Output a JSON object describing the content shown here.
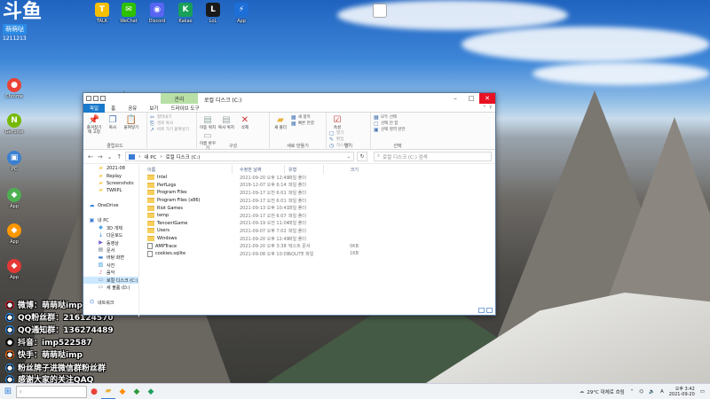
{
  "desktop": {
    "icons_top": [
      {
        "label": "TALK",
        "color": "#f6c000",
        "glyph": "T",
        "icon": "talk-icon"
      },
      {
        "label": "WeChat",
        "color": "#2dc100",
        "glyph": "✉",
        "icon": "wechat-icon"
      },
      {
        "label": "Discord",
        "color": "#5865f2",
        "glyph": "◉",
        "icon": "discord-icon"
      },
      {
        "label": "Kakao",
        "color": "#19a058",
        "glyph": "K",
        "icon": "app-icon"
      },
      {
        "label": "LoL",
        "color": "#1a1a1a",
        "glyph": "L",
        "icon": "game-icon"
      },
      {
        "label": "App",
        "color": "#1e6ed8",
        "glyph": "⚡",
        "icon": "bolt-icon"
      }
    ],
    "icons_left": [
      {
        "label": "Chrome",
        "color": "#e94235",
        "glyph": "●",
        "icon": "chrome-icon"
      },
      {
        "label": "GeForce",
        "color": "#76b900",
        "glyph": "N",
        "icon": "nvidia-icon"
      },
      {
        "label": "PC",
        "color": "#3a80d2",
        "glyph": "▣",
        "icon": "computer-icon"
      },
      {
        "label": "App",
        "color": "#4caf50",
        "glyph": "◆",
        "icon": "app-icon"
      },
      {
        "label": "App",
        "color": "#ff9800",
        "glyph": "◆",
        "icon": "app-icon"
      },
      {
        "label": "App",
        "color": "#e53935",
        "glyph": "◆",
        "icon": "app-icon"
      }
    ],
    "icons_right": [
      {
        "label": "",
        "color": "#ffffff",
        "glyph": "",
        "icon": "document-icon"
      }
    ]
  },
  "overlay": {
    "logo_big": "斗鱼",
    "logo_tag": "萌萌哒",
    "logo_num": "1211213",
    "lines": [
      {
        "text": "微博：萌萌哒imp",
        "color": "#e6162d"
      },
      {
        "text": "QQ粉丝群：216124570",
        "color": "#1e90ff"
      },
      {
        "text": "QQ通知群：136274489",
        "color": "#1e90ff"
      },
      {
        "text": "抖音：imp522587",
        "color": "#111111"
      },
      {
        "text": "快手：萌萌哒imp",
        "color": "#ff6a00"
      },
      {
        "text": "粉丝牌子进微信群粉丝群",
        "color": "#2b8be6"
      },
      {
        "text": "感谢大家的关注QAQ",
        "color": "#2b8be6"
      }
    ]
  },
  "explorer": {
    "title": "로컬 디스크 (C:)",
    "context_tab": "관리",
    "tabs": [
      "파일",
      "홈",
      "공유",
      "보기",
      "드라이브 도구"
    ],
    "ribbon": {
      "clipboard": {
        "label": "클립보드",
        "pin": "즐겨찾기에 고정",
        "copy": "복사",
        "paste": "붙여넣기",
        "cut": "잘라내기",
        "copy_path": "경로 복사",
        "paste_shortcut": "바로 가기 붙여넣기"
      },
      "organize": {
        "label": "구성",
        "move": "이동 위치",
        "copyto": "복사 위치",
        "delete": "삭제",
        "rename": "이름 바꾸기"
      },
      "new": {
        "label": "새로 만들기",
        "folder": "새 폴더",
        "item": "새 항목",
        "easy": "빠른 연결"
      },
      "open": {
        "label": "열기",
        "props": "속성",
        "open": "열기",
        "edit": "편집",
        "history": "히스토리"
      },
      "select": {
        "label": "선택",
        "all": "모두 선택",
        "none": "선택 안 함",
        "invert": "선택 영역 반전"
      }
    },
    "address": {
      "crumbs": [
        "내 PC",
        "로컬 디스크 (C:)"
      ],
      "search_placeholder": "로컬 디스크 (C:) 검색"
    },
    "nav": [
      {
        "label": "2021-08",
        "kind": "folder",
        "indent": true
      },
      {
        "label": "Replay",
        "kind": "folder",
        "indent": true
      },
      {
        "label": "Screenshots",
        "kind": "folder",
        "indent": true
      },
      {
        "label": "TWRPL",
        "kind": "folder",
        "indent": true
      },
      {
        "label": "",
        "kind": "blank",
        "indent": false
      },
      {
        "label": "OneDrive",
        "kind": "cloud",
        "indent": false
      },
      {
        "label": "",
        "kind": "blank",
        "indent": false
      },
      {
        "label": "내 PC",
        "kind": "pc",
        "indent": false
      },
      {
        "label": "3D 개체",
        "kind": "obj",
        "indent": true
      },
      {
        "label": "다운로드",
        "kind": "down",
        "indent": true
      },
      {
        "label": "동영상",
        "kind": "video",
        "indent": true
      },
      {
        "label": "문서",
        "kind": "doc",
        "indent": true
      },
      {
        "label": "바탕 화면",
        "kind": "desk",
        "indent": true
      },
      {
        "label": "사진",
        "kind": "pic",
        "indent": true
      },
      {
        "label": "음악",
        "kind": "music",
        "indent": true
      },
      {
        "label": "로컬 디스크 (C:)",
        "kind": "drive",
        "indent": true,
        "selected": true
      },
      {
        "label": "새 볼륨 (D:)",
        "kind": "drive",
        "indent": true
      },
      {
        "label": "",
        "kind": "blank",
        "indent": false
      },
      {
        "label": "네트워크",
        "kind": "net",
        "indent": false
      }
    ],
    "columns": [
      "이름",
      "수정한 날짜",
      "유형",
      "크기"
    ],
    "files": [
      {
        "name": "Intel",
        "date": "2021-09-20 오후 12:49",
        "type": "파일 폴더",
        "size": "",
        "kind": "folder"
      },
      {
        "name": "PerfLogs",
        "date": "2019-12-07 오후 6:14",
        "type": "파일 폴더",
        "size": "",
        "kind": "folder"
      },
      {
        "name": "Program Files",
        "date": "2021-09-17 오전 6:01",
        "type": "파일 폴더",
        "size": "",
        "kind": "folder"
      },
      {
        "name": "Program Files (x86)",
        "date": "2021-09-17 오전 6:01",
        "type": "파일 폴더",
        "size": "",
        "kind": "folder"
      },
      {
        "name": "Riot Games",
        "date": "2021-09-13 오후 10:41",
        "type": "파일 폴더",
        "size": "",
        "kind": "folder"
      },
      {
        "name": "temp",
        "date": "2021-09-17 오전 6:07",
        "type": "파일 폴더",
        "size": "",
        "kind": "folder"
      },
      {
        "name": "TencentGame",
        "date": "2021-09-19 오전 11:04",
        "type": "파일 폴더",
        "size": "",
        "kind": "folder"
      },
      {
        "name": "Users",
        "date": "2021-09-07 오후 7:02",
        "type": "파일 폴더",
        "size": "",
        "kind": "folder"
      },
      {
        "name": "Windows",
        "date": "2021-09-20 오후 12:49",
        "type": "파일 폴더",
        "size": "",
        "kind": "folder"
      },
      {
        "name": "AMPTrace",
        "date": "2021-09-20 오후 3:38",
        "type": "텍스트 문서",
        "size": "0KB",
        "kind": "file"
      },
      {
        "name": "cookies.sqlite",
        "date": "2021-09-08 오후 10:09",
        "type": "SQLITE 파일",
        "size": "1KB",
        "kind": "file"
      }
    ]
  },
  "taskbar": {
    "search_placeholder": "",
    "weather": "29°C 대체로 흐림",
    "time": "오후 3:42",
    "date": "2021-09-20",
    "apps": [
      "chrome-icon",
      "folder-icon",
      "app-icon",
      "app-icon",
      "app-icon"
    ]
  }
}
